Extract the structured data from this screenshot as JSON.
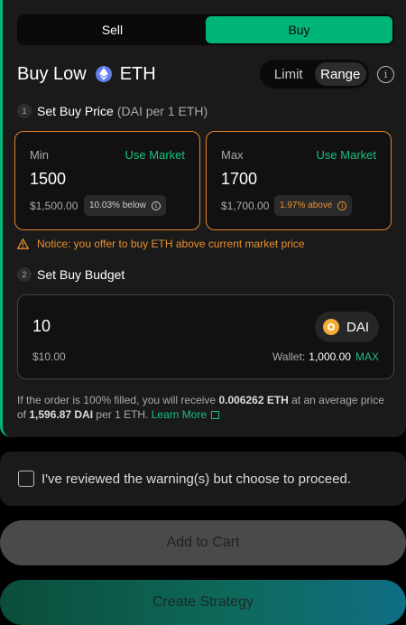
{
  "side_toggle": {
    "sell": "Sell",
    "buy": "Buy"
  },
  "header": {
    "title": "Buy Low",
    "token": "ETH"
  },
  "mode_toggle": {
    "limit": "Limit",
    "range": "Range"
  },
  "step1": {
    "num": "1",
    "label": "Set Buy Price",
    "sub": "(DAI per 1 ETH)"
  },
  "min_box": {
    "label": "Min",
    "use_market": "Use Market",
    "value": "1500",
    "usd": "$1,500.00",
    "badge": "10.03% below",
    "badge_color": "#cfcfcf"
  },
  "max_box": {
    "label": "Max",
    "use_market": "Use Market",
    "value": "1700",
    "usd": "$1,700.00",
    "badge": "1.97% above",
    "badge_color": "#e8902f"
  },
  "notice": "Notice: you offer to buy ETH above current market price",
  "step2": {
    "num": "2",
    "label": "Set Buy Budget"
  },
  "budget": {
    "amount": "10",
    "token": "DAI",
    "usd": "$10.00",
    "wallet_label": "Wallet:",
    "wallet_value": "1,000.00",
    "max": "MAX"
  },
  "summary": {
    "p1": "If the order is 100% filled, you will receive ",
    "receive": "0.006262 ETH",
    "p2": " at an average price of ",
    "avg_price": "1,596.87 DAI",
    "p3": " per 1 ETH. ",
    "learn_more": "Learn More"
  },
  "warning": "I've reviewed the warning(s) but choose to proceed.",
  "buttons": {
    "add_to_cart": "Add to Cart",
    "create": "Create Strategy"
  },
  "colors": {
    "accent": "#00b578",
    "warning": "#e8902f",
    "eth": "#627eea",
    "dai": "#f5ac37"
  }
}
